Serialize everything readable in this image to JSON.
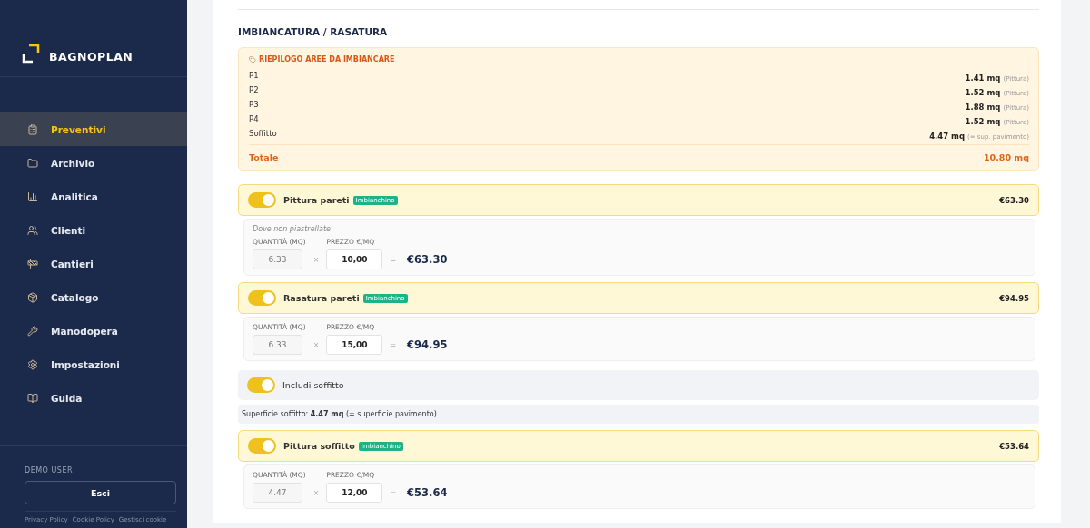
{
  "sidebar": {
    "logo": "BAGNOPLAN",
    "items": [
      {
        "label": "Preventivi",
        "selected": true
      },
      {
        "label": "Archivio",
        "selected": false
      },
      {
        "label": "Analitica",
        "selected": false
      },
      {
        "label": "Clienti",
        "selected": false
      },
      {
        "label": "Cantieri",
        "selected": false
      },
      {
        "label": "Catalogo",
        "selected": false
      },
      {
        "label": "Manodopera",
        "selected": false
      },
      {
        "label": "Impostazioni",
        "selected": false
      },
      {
        "label": "Guida",
        "selected": false
      }
    ],
    "user": "DEMO USER",
    "logout": "Esci",
    "links": [
      "Privacy Policy",
      "Cookie Policy",
      "Gestisci cookie"
    ]
  },
  "section": {
    "title": "IMBIANCATURA / RASATURA",
    "summary": {
      "title": "RIEPILOGO AREE DA IMBIANCARE",
      "rows": [
        {
          "label": "P1",
          "value": "1.41 mq",
          "note": "(Pittura)"
        },
        {
          "label": "P2",
          "value": "1.52 mq",
          "note": "(Pittura)"
        },
        {
          "label": "P3",
          "value": "1.88 mq",
          "note": "(Pittura)"
        },
        {
          "label": "P4",
          "value": "1.52 mq",
          "note": "(Pittura)"
        },
        {
          "label": "Soffitto",
          "value": "4.47 mq",
          "note": "(= sup. pavimento)"
        }
      ],
      "total_label": "Totale",
      "total_value": "10.80 mq"
    },
    "items": [
      {
        "kind": "service",
        "label": "Pittura pareti",
        "tag": "Imbianchino",
        "on": true,
        "price": "€63.30",
        "hint": "Dove non piastrellate",
        "qty_label": "QUANTITÀ (MQ)",
        "qty": "6.33",
        "times": "×",
        "unit_label": "PREZZO €/MQ",
        "unit": "10,00",
        "equals": "=",
        "total": "€63.30"
      },
      {
        "kind": "service",
        "label": "Rasatura pareti",
        "tag": "Imbianchino",
        "on": true,
        "price": "€94.95",
        "qty_label": "QUANTITÀ (MQ)",
        "qty": "6.33",
        "times": "×",
        "unit_label": "PREZZO €/MQ",
        "unit": "15,00",
        "equals": "=",
        "total": "€94.95"
      },
      {
        "kind": "toggle",
        "label": "Includi soffitto",
        "on": true
      },
      {
        "kind": "note",
        "text": "Superficie soffitto: **4.47 mq** (= superficie pavimento)"
      },
      {
        "kind": "service",
        "label": "Pittura soffitto",
        "tag": "Imbianchino",
        "on": true,
        "price": "€53.64",
        "qty_label": "QUANTITÀ (MQ)",
        "qty": "4.47",
        "times": "×",
        "unit_label": "PREZZO €/MQ",
        "unit": "12,00",
        "equals": "=",
        "total": "€53.64"
      }
    ]
  }
}
